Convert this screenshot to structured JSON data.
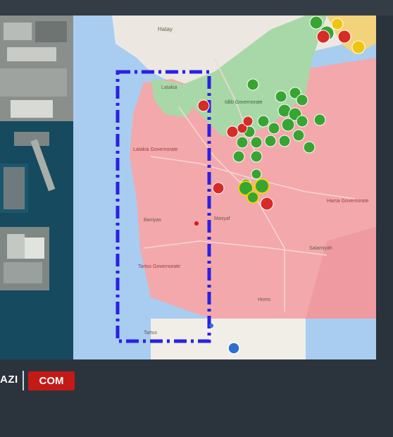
{
  "branding": {
    "left_text": "AZI",
    "badge_text": "COM"
  },
  "map": {
    "place_labels": [
      "Hatay",
      "Latakia",
      "Idlib Governorate",
      "Latakia Governorate",
      "Hama Governorate",
      "Tartus Governorate",
      "Baniyas",
      "Tartus",
      "Masyaf",
      "Salamiyah",
      "Homs"
    ],
    "colors": {
      "government_zone": "#f3a8ab",
      "opposition_zone": "#a9d8a8",
      "turkey_zone": "#f2d27a",
      "sea": "#a8cdf0",
      "selection_box": "#2a20e6"
    }
  }
}
